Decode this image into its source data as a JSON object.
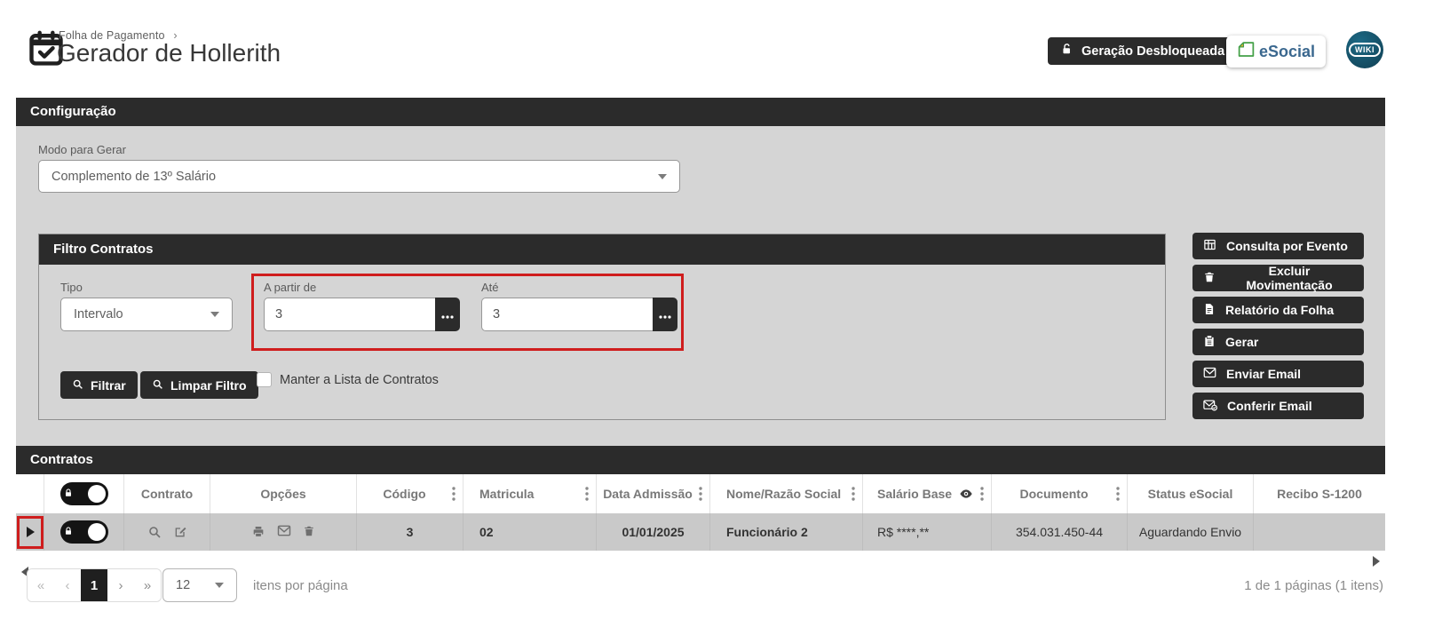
{
  "colors": {
    "dark_bar": "#2b2b2b",
    "highlight_red": "#cf1d1d",
    "panel_gray": "#d5d5d5",
    "row_gray": "#c9c9c9",
    "esocial_blue": "#3b688f",
    "esocial_green": "#43a047",
    "wiki_teal": "#155670"
  },
  "header": {
    "breadcrumb": "Folha de Pagamento",
    "breadcrumb_separator": "›",
    "title": "Gerador de Hollerith",
    "unlock_button": "Geração Desbloqueada",
    "esocial_label": "eSocial",
    "wiki_label": "WIKI"
  },
  "config": {
    "section_title": "Configuração",
    "modo_label": "Modo para Gerar",
    "modo_value": "Complemento de 13º Salário"
  },
  "filter": {
    "section_title": "Filtro Contratos",
    "tipo_label": "Tipo",
    "tipo_value": "Intervalo",
    "from_label": "A partir de",
    "from_value": "3",
    "to_label": "Até",
    "to_value": "3",
    "filtrar_button": "Filtrar",
    "limpar_button": "Limpar Filtro",
    "checkbox_label": "Manter a Lista de Contratos"
  },
  "actions": [
    {
      "label": "Consulta por Evento",
      "icon": "table-grid-icon"
    },
    {
      "label": "Excluir Movimentação",
      "icon": "trash-icon"
    },
    {
      "label": "Relatório da Folha",
      "icon": "document-icon"
    },
    {
      "label": "Gerar",
      "icon": "clipboard-icon"
    },
    {
      "label": "Enviar Email",
      "icon": "envelope-icon"
    },
    {
      "label": "Conferir Email",
      "icon": "envelope-check-icon"
    }
  ],
  "contracts": {
    "section_title": "Contratos",
    "columns": [
      "Contrato",
      "Opções",
      "Código",
      "Matricula",
      "Data Admissão",
      "Nome/Razão Social",
      "Salário Base",
      "Documento",
      "Status eSocial",
      "Recibo S-1200"
    ],
    "rows": [
      {
        "codigo": "3",
        "matricula": "02",
        "data_admissao": "01/01/2025",
        "nome_razao_social": "Funcionário 2",
        "salario_base": "R$ ****,**",
        "documento": "354.031.450-44",
        "status_esocial": "Aguardando Envio",
        "recibo_s1200": ""
      }
    ]
  },
  "pagination": {
    "first_label": "«",
    "prev_label": "‹",
    "current_page": "1",
    "next_label": "›",
    "last_label": "»",
    "page_size": "12",
    "items_per_page_label": "itens por página",
    "summary": "1 de 1 páginas (1 itens)"
  }
}
